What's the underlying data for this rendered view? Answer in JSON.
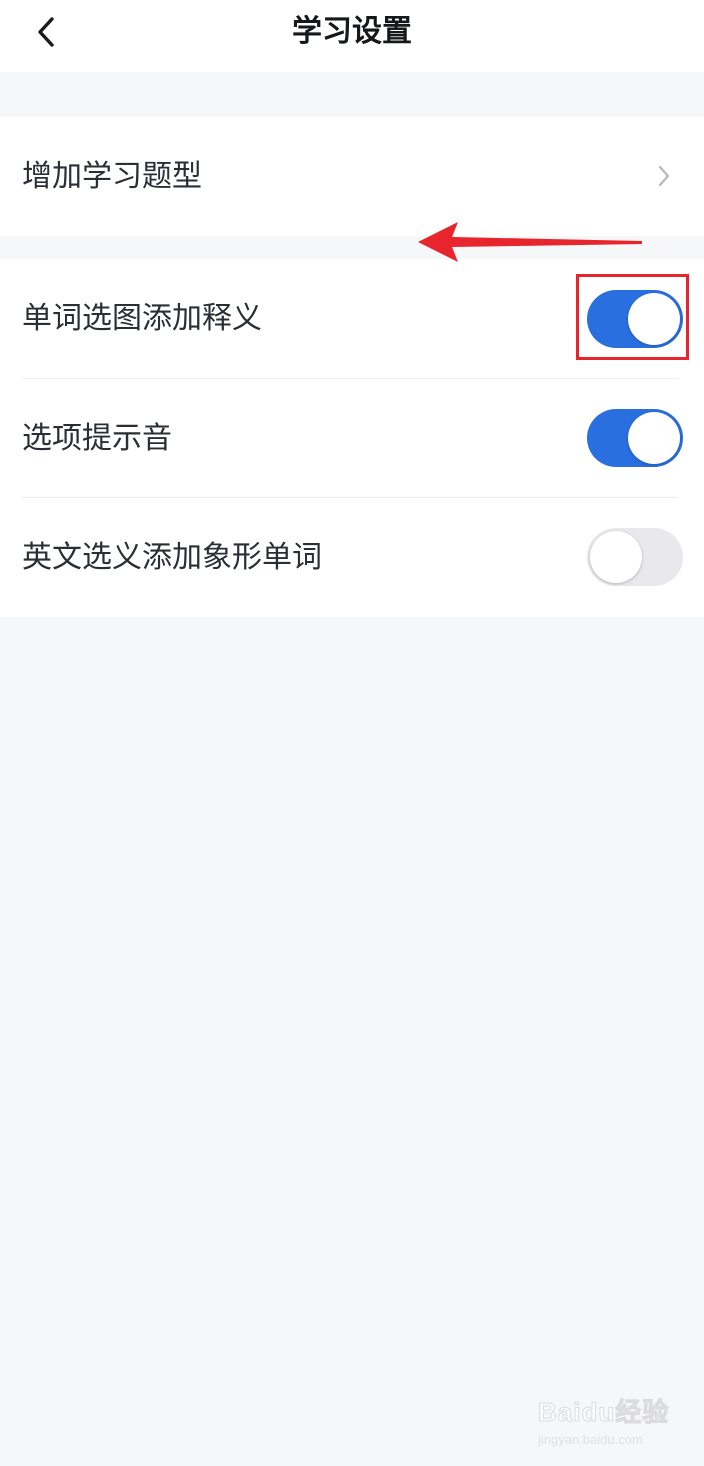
{
  "header": {
    "title": "学习设置",
    "back_icon": "chevron-left-icon"
  },
  "section_question_types": {
    "label": "增加学习题型",
    "chevron_icon": "chevron-right-icon"
  },
  "settings": [
    {
      "label": "单词选图添加释义",
      "enabled": true
    },
    {
      "label": "选项提示音",
      "enabled": true
    },
    {
      "label": "英文选义添加象形单词",
      "enabled": false
    }
  ],
  "annotations": {
    "arrow_color": "#e8242c",
    "box_color": "#e8242c"
  },
  "colors": {
    "toggle_on": "#2a6fe0",
    "toggle_off": "#e9e9eb",
    "page_background": "#f6f7f9"
  },
  "watermark": {
    "main": "Baidu经验",
    "sub": "jingyan.baidu.com"
  }
}
